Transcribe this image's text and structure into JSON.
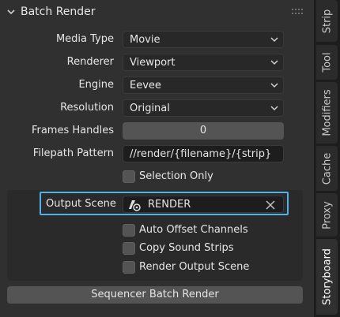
{
  "panel": {
    "title": "Batch Render"
  },
  "fields": {
    "media_type": {
      "label": "Media Type",
      "value": "Movie"
    },
    "renderer": {
      "label": "Renderer",
      "value": "Viewport"
    },
    "engine": {
      "label": "Engine",
      "value": "Eevee"
    },
    "resolution": {
      "label": "Resolution",
      "value": "Original"
    },
    "frames_handles": {
      "label": "Frames Handles",
      "value": "0"
    },
    "filepath_pattern": {
      "label": "Filepath Pattern",
      "value": "//render/{filename}/{strip}"
    }
  },
  "checkboxes": {
    "selection_only": {
      "label": "Selection Only",
      "checked": false
    },
    "auto_offset": {
      "label": "Auto Offset Channels",
      "checked": false
    },
    "copy_sound": {
      "label": "Copy Sound Strips",
      "checked": false
    },
    "render_output_scene": {
      "label": "Render Output Scene",
      "checked": false
    }
  },
  "output_scene": {
    "label": "Output Scene",
    "value": "RENDER"
  },
  "render_button": {
    "label": "Sequencer Batch Render"
  },
  "tabs": [
    {
      "label": "Strip",
      "active": false
    },
    {
      "label": "Tool",
      "active": false
    },
    {
      "label": "Modifiers",
      "active": false
    },
    {
      "label": "Cache",
      "active": false
    },
    {
      "label": "Proxy",
      "active": false
    },
    {
      "label": "Storyboard",
      "active": true
    }
  ],
  "colors": {
    "panel_bg": "#303030",
    "focus_outline": "#4eb1e8",
    "text": "#e6e6e6"
  }
}
